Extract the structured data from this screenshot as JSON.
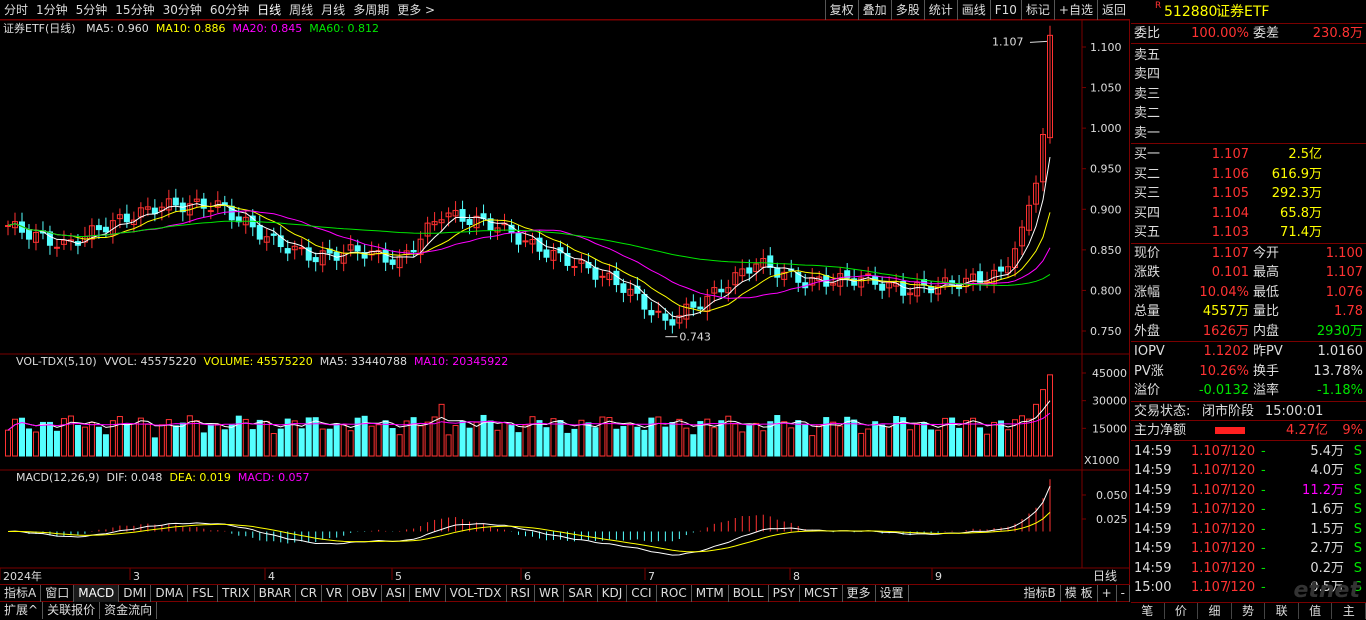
{
  "toolbar": {
    "periods": [
      "分时",
      "1分钟",
      "5分钟",
      "15分钟",
      "30分钟",
      "60分钟",
      "日线",
      "周线",
      "月线",
      "多周期",
      "更多 >"
    ],
    "active_period": "日线",
    "tools": [
      "复权",
      "叠加",
      "多股",
      "统计",
      "画线",
      "F10",
      "标记",
      "+自选",
      "返回"
    ]
  },
  "main_chart": {
    "legend_title": "证券ETF(日线)",
    "ma5": "MA5: 0.960",
    "ma10": "MA10: 0.886",
    "ma20": "MA20: 0.845",
    "ma60": "MA60: 0.812",
    "high_label": "1.107",
    "low_label": "0.743",
    "y_ticks": [
      "1.100",
      "1.050",
      "1.000",
      "0.950",
      "0.900",
      "0.850",
      "0.800",
      "0.750"
    ],
    "colors": {
      "up": "#ff3232",
      "down": "#54ffff",
      "ma5": "#ffffff",
      "ma10": "#ffff00",
      "ma20": "#ff00ff",
      "ma60": "#00e600",
      "grid": "#7a0000"
    }
  },
  "volume_chart": {
    "legend_title": "VOL-TDX(5,10)",
    "vvol": "VVOL: 45575220",
    "volume": "VOLUME: 45575220",
    "ma5": "MA5: 33440788",
    "ma10": "MA10: 20345922",
    "y_ticks": [
      "45000",
      "30000",
      "15000"
    ],
    "unit": "X1000"
  },
  "macd_chart": {
    "legend_title": "MACD(12,26,9)",
    "dif": "DIF: 0.048",
    "dea": "DEA: 0.019",
    "macd": "MACD: 0.057",
    "y_ticks": [
      "0.050",
      "0.025"
    ]
  },
  "time_axis": {
    "labels": [
      "2024年",
      "3",
      "4",
      "5",
      "6",
      "7",
      "8",
      "9"
    ],
    "right_label": "日线"
  },
  "indicator_tabs": {
    "row1": [
      "指标A",
      "窗口",
      "MACD",
      "DMI",
      "DMA",
      "FSL",
      "TRIX",
      "BRAR",
      "CR",
      "VR",
      "OBV",
      "ASI",
      "EMV",
      "VOL-TDX",
      "RSI",
      "WR",
      "SAR",
      "KDJ",
      "CCI",
      "ROC",
      "MTM",
      "BOLL",
      "PSY",
      "MCST",
      "更多",
      "设置"
    ],
    "row1_right": [
      "指标B",
      "模 板",
      "+",
      "-"
    ],
    "row2": [
      "扩展^",
      "关联报价",
      "资金流向"
    ]
  },
  "quote": {
    "code": "512880",
    "name": "证券ETF",
    "r_mark": "R",
    "weibi_label": "委比",
    "weibi": "100.00%",
    "weicha_label": "委差",
    "weicha": "230.8万",
    "sell": [
      {
        "label": "卖五",
        "price": "",
        "vol": ""
      },
      {
        "label": "卖四",
        "price": "",
        "vol": ""
      },
      {
        "label": "卖三",
        "price": "",
        "vol": ""
      },
      {
        "label": "卖二",
        "price": "",
        "vol": ""
      },
      {
        "label": "卖一",
        "price": "",
        "vol": ""
      }
    ],
    "buy": [
      {
        "label": "买一",
        "price": "1.107",
        "vol": "2.5亿"
      },
      {
        "label": "买二",
        "price": "1.106",
        "vol": "616.9万"
      },
      {
        "label": "买三",
        "price": "1.105",
        "vol": "292.3万"
      },
      {
        "label": "买四",
        "price": "1.104",
        "vol": "65.8万"
      },
      {
        "label": "买五",
        "price": "1.103",
        "vol": "71.4万"
      }
    ],
    "stats": [
      {
        "l1": "现价",
        "v1": "1.107",
        "c1": "red",
        "l2": "今开",
        "v2": "1.100",
        "c2": "red"
      },
      {
        "l1": "涨跌",
        "v1": "0.101",
        "c1": "red",
        "l2": "最高",
        "v2": "1.107",
        "c2": "red"
      },
      {
        "l1": "涨幅",
        "v1": "10.04%",
        "c1": "red",
        "l2": "最低",
        "v2": "1.076",
        "c2": "red"
      },
      {
        "l1": "总量",
        "v1": "4557万",
        "c1": "yellow",
        "l2": "量比",
        "v2": "1.78",
        "c2": "red"
      },
      {
        "l1": "外盘",
        "v1": "1626万",
        "c1": "red",
        "l2": "内盘",
        "v2": "2930万",
        "c2": "green"
      }
    ],
    "iopv": [
      {
        "l1": "IOPV",
        "v1": "1.1202",
        "c1": "red",
        "l2": "昨PV",
        "v2": "1.0160",
        "c2": "white"
      },
      {
        "l1": "PV涨",
        "v1": "10.26%",
        "c1": "red",
        "l2": "换手",
        "v2": "13.78%",
        "c2": "white"
      },
      {
        "l1": "溢价",
        "v1": "-0.0132",
        "c1": "green",
        "l2": "溢率",
        "v2": "-1.18%",
        "c2": "green"
      }
    ],
    "trade_status_label": "交易状态:",
    "trade_status": "闭市阶段",
    "trade_time": "15:00:01",
    "main_net_label": "主力净额",
    "main_net": "4.27亿",
    "main_net_pct": "9%",
    "ticks": [
      {
        "time": "14:59",
        "price": "1.107",
        "ref": "/120",
        "dash": "-",
        "vol": "5.4万",
        "vc": "white",
        "side": "S"
      },
      {
        "time": "14:59",
        "price": "1.107",
        "ref": "/120",
        "dash": "-",
        "vol": "4.0万",
        "vc": "white",
        "side": "S"
      },
      {
        "time": "14:59",
        "price": "1.107",
        "ref": "/120",
        "dash": "-",
        "vol": "11.2万",
        "vc": "magenta",
        "side": "S"
      },
      {
        "time": "14:59",
        "price": "1.107",
        "ref": "/120",
        "dash": "-",
        "vol": "1.6万",
        "vc": "white",
        "side": "S"
      },
      {
        "time": "14:59",
        "price": "1.107",
        "ref": "/120",
        "dash": "-",
        "vol": "1.5万",
        "vc": "white",
        "side": "S"
      },
      {
        "time": "14:59",
        "price": "1.107",
        "ref": "/120",
        "dash": "-",
        "vol": "2.7万",
        "vc": "white",
        "side": "S"
      },
      {
        "time": "14:59",
        "price": "1.107",
        "ref": "/120",
        "dash": "-",
        "vol": "0.2万",
        "vc": "white",
        "side": "S"
      },
      {
        "time": "15:00",
        "price": "1.107",
        "ref": "/120",
        "dash": "-",
        "vol": "0.5万",
        "vc": "white",
        "side": "S"
      }
    ],
    "bottom_tabs": [
      "笔",
      "价",
      "细",
      "势",
      "联",
      "值",
      "主"
    ],
    "watermark": "etnet"
  }
}
